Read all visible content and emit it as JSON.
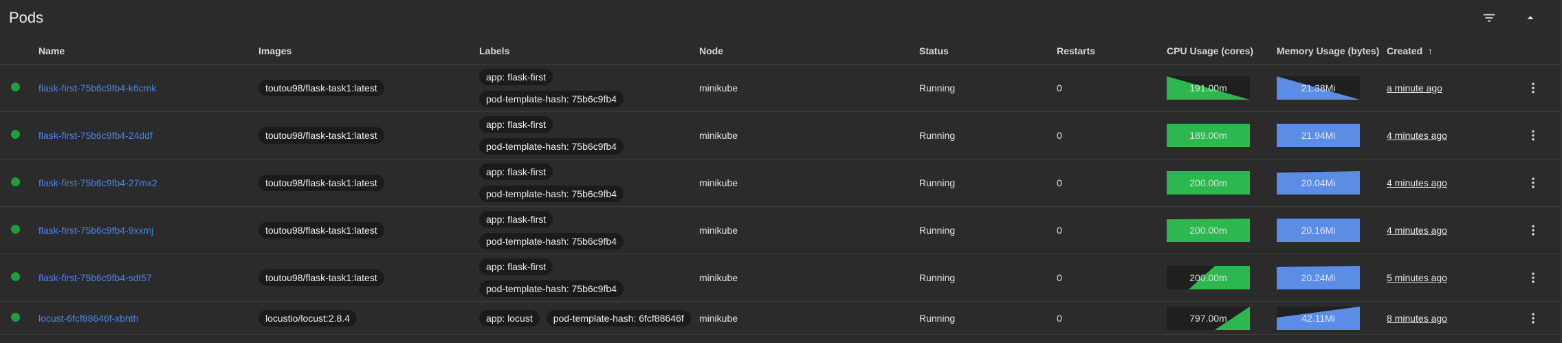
{
  "title": "Pods",
  "columns": {
    "name": "Name",
    "images": "Images",
    "labels": "Labels",
    "node": "Node",
    "status": "Status",
    "restarts": "Restarts",
    "cpu": "CPU Usage (cores)",
    "memory": "Memory Usage (bytes)",
    "created": "Created",
    "sort_indicator": "↑"
  },
  "colors": {
    "running_dot": "#1e9e3e",
    "link": "#4a86e8",
    "cpu_fill": "#2db84f",
    "mem_fill": "#5b8de6"
  },
  "icons": {
    "filter": "filter-list-icon",
    "collapse": "arrow-drop-up-icon",
    "row_menu": "more-vert-icon",
    "sort": "arrow-up-icon"
  },
  "pods": [
    {
      "name": "flask-first-75b6c9fb4-k6cmk",
      "image": "toutou98/flask-task1:latest",
      "labels": [
        "app: flask-first",
        "pod-template-hash: 75b6c9fb4"
      ],
      "node": "minikube",
      "status": "Running",
      "restarts": "0",
      "cpu": "191.00m",
      "memory": "21.38Mi",
      "created": "a minute ago"
    },
    {
      "name": "flask-first-75b6c9fb4-24ddf",
      "image": "toutou98/flask-task1:latest",
      "labels": [
        "app: flask-first",
        "pod-template-hash: 75b6c9fb4"
      ],
      "node": "minikube",
      "status": "Running",
      "restarts": "0",
      "cpu": "189.00m",
      "memory": "21.94Mi",
      "created": "4 minutes ago"
    },
    {
      "name": "flask-first-75b6c9fb4-27mx2",
      "image": "toutou98/flask-task1:latest",
      "labels": [
        "app: flask-first",
        "pod-template-hash: 75b6c9fb4"
      ],
      "node": "minikube",
      "status": "Running",
      "restarts": "0",
      "cpu": "200.00m",
      "memory": "20.04Mi",
      "created": "4 minutes ago"
    },
    {
      "name": "flask-first-75b6c9fb4-9xxmj",
      "image": "toutou98/flask-task1:latest",
      "labels": [
        "app: flask-first",
        "pod-template-hash: 75b6c9fb4"
      ],
      "node": "minikube",
      "status": "Running",
      "restarts": "0",
      "cpu": "200.00m",
      "memory": "20.16Mi",
      "created": "4 minutes ago"
    },
    {
      "name": "flask-first-75b6c9fb4-sdt57",
      "image": "toutou98/flask-task1:latest",
      "labels": [
        "app: flask-first",
        "pod-template-hash: 75b6c9fb4"
      ],
      "node": "minikube",
      "status": "Running",
      "restarts": "0",
      "cpu": "200.00m",
      "memory": "20.24Mi",
      "created": "5 minutes ago"
    },
    {
      "name": "locust-6fcf88646f-xbhth",
      "image": "locustio/locust:2.8.4",
      "labels": [
        "app: locust",
        "pod-template-hash: 6fcf88646f"
      ],
      "node": "minikube",
      "status": "Running",
      "restarts": "0",
      "cpu": "797.00m",
      "memory": "42.11Mi",
      "created": "8 minutes ago"
    }
  ]
}
